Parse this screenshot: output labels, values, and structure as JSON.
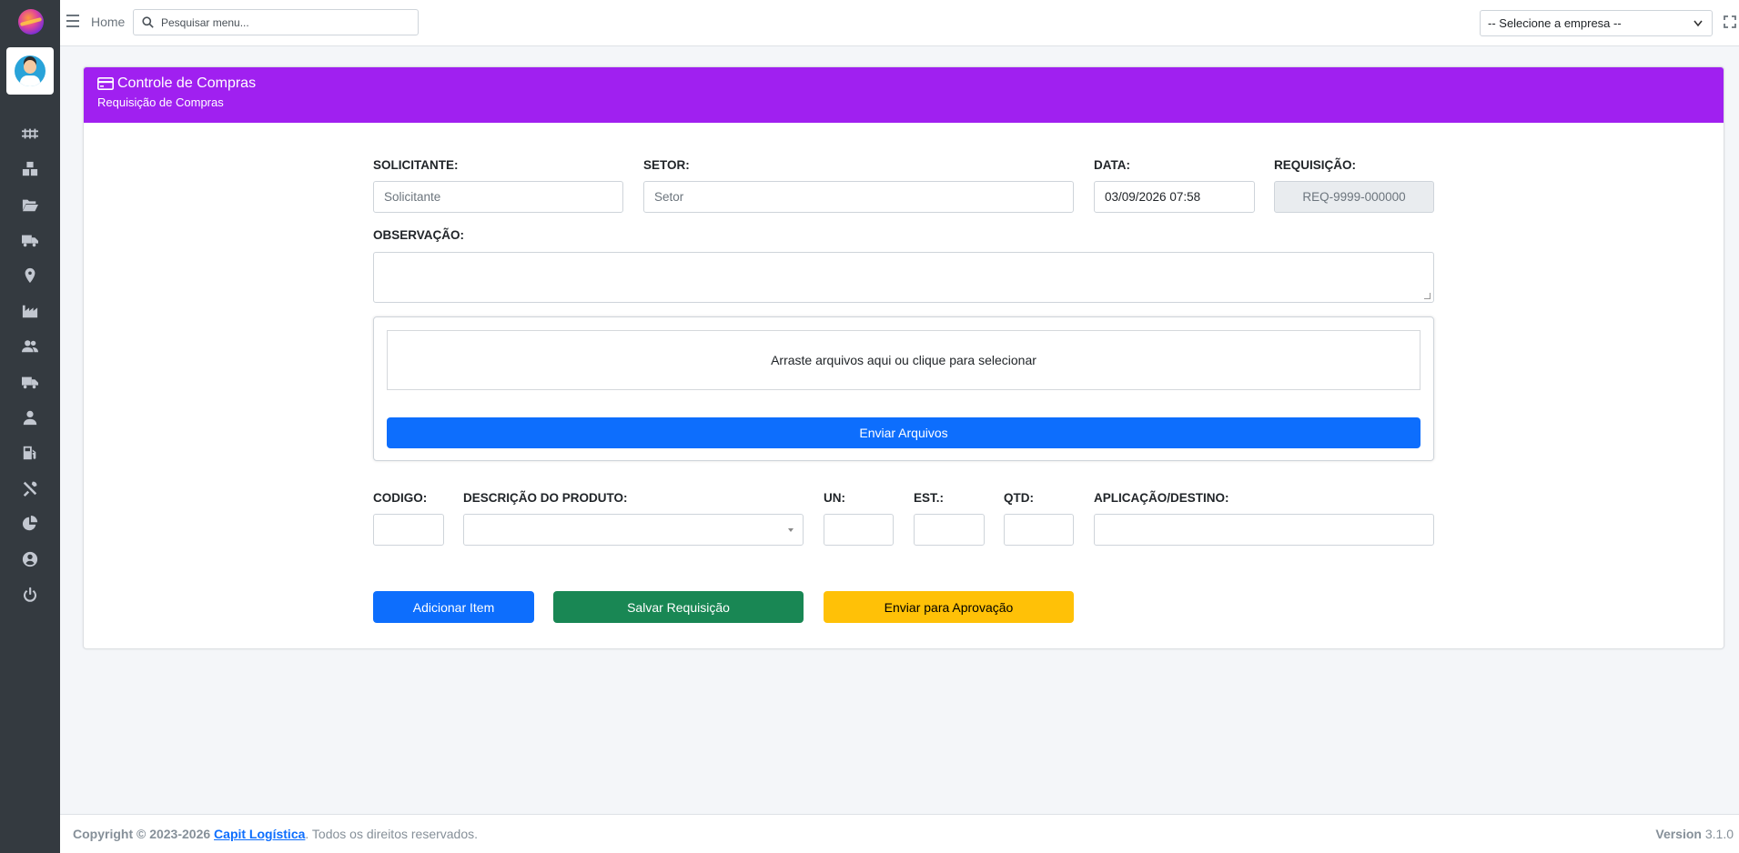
{
  "app": {
    "brand_color": "#a020f0"
  },
  "topbar": {
    "home_label": "Home",
    "search_placeholder": "Pesquisar menu...",
    "company_select": "-- Selecione a empresa --"
  },
  "sidebar": {
    "items": [
      {
        "icon": "rail-track-icon"
      },
      {
        "icon": "boxes-icon"
      },
      {
        "icon": "folder-open-icon"
      },
      {
        "icon": "truck-loading-icon"
      },
      {
        "icon": "map-marker-icon"
      },
      {
        "icon": "industry-icon"
      },
      {
        "icon": "users-icon"
      },
      {
        "icon": "truck-icon"
      },
      {
        "icon": "user-icon"
      },
      {
        "icon": "gas-pump-icon"
      },
      {
        "icon": "tools-icon"
      },
      {
        "icon": "chart-pie-icon"
      },
      {
        "icon": "user-circle-icon"
      },
      {
        "icon": "power-off-icon"
      }
    ]
  },
  "card": {
    "title": "Controle de Compras",
    "subtitle": "Requisição de Compras"
  },
  "form": {
    "solicitante": {
      "label": "SOLICITANTE:",
      "placeholder": "Solicitante"
    },
    "setor": {
      "label": "SETOR:",
      "placeholder": "Setor"
    },
    "data": {
      "label": "DATA:",
      "value": "03/09/2026 07:58"
    },
    "requisicao": {
      "label": "REQUISIÇÃO:",
      "value": "REQ-9999-000000"
    },
    "observacao": {
      "label": "OBSERVAÇÃO:",
      "value": ""
    }
  },
  "upload": {
    "dropzone_text": "Arraste arquivos aqui ou clique para selecionar",
    "button": "Enviar Arquivos"
  },
  "item": {
    "codigo_label": "CODIGO:",
    "descricao_label": "DESCRIÇÃO DO PRODUTO:",
    "un_label": "UN:",
    "est_label": "EST.:",
    "qtd_label": "QTD:",
    "aplicacao_label": "APLICAÇÃO/DESTINO:"
  },
  "actions": {
    "add_item": "Adicionar Item",
    "save": "Salvar Requisição",
    "send_approval": "Enviar para Aprovação"
  },
  "footer": {
    "copyright": "Copyright © 2023-2026",
    "company_link": "Capit Logística",
    "rights": ". Todos os direitos reservados.",
    "version_label": "Version",
    "version": "3.1.0"
  }
}
